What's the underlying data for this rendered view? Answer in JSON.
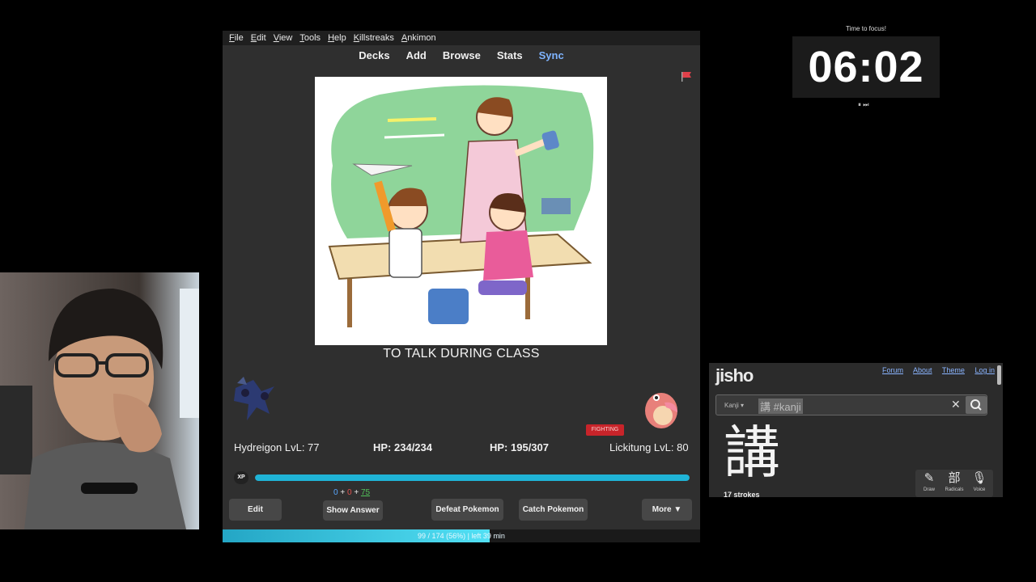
{
  "anki": {
    "menu": [
      "File",
      "Edit",
      "View",
      "Tools",
      "Help",
      "Killstreaks",
      "Ankimon"
    ],
    "toolbar": [
      "Decks",
      "Add",
      "Browse",
      "Stats",
      "Sync"
    ],
    "answer_text": "TO TALK DURING CLASS",
    "battle": {
      "player_stat": "Hydreigon LvL: 77",
      "player_hp": "HP: 234/234",
      "enemy_hp": "HP: 195/307",
      "enemy_stat": "Lickitung LvL: 80",
      "enemy_type": "FIGHTING"
    },
    "xp_label": "XP",
    "xp_fraction": 1.0,
    "counts": {
      "new": "0",
      "learn": "0",
      "review": "75",
      "plus": "+"
    },
    "buttons": {
      "edit": "Edit",
      "show_answer": "Show Answer",
      "defeat": "Defeat Pokemon",
      "catch": "Catch Pokemon",
      "more": "More ▼"
    },
    "progress": {
      "fraction": 0.56,
      "text": "99 / 174 (56%) | left 39 min"
    }
  },
  "timer": {
    "label": "Time to focus!",
    "digits": "06:02",
    "controls": "⏸ ⏭"
  },
  "jisho": {
    "logo": "jisho",
    "links": [
      "Forum",
      "About",
      "Theme",
      "Log in"
    ],
    "search_scope": "Kanji ▾",
    "query": "講 #kanji",
    "clear": "✕",
    "kanji": "講",
    "strokes": "17 strokes",
    "tools": [
      {
        "icon": "✎",
        "label": "Draw"
      },
      {
        "icon": "部",
        "label": "Radicals"
      },
      {
        "icon": "🎙",
        "label": "Voice"
      }
    ]
  }
}
